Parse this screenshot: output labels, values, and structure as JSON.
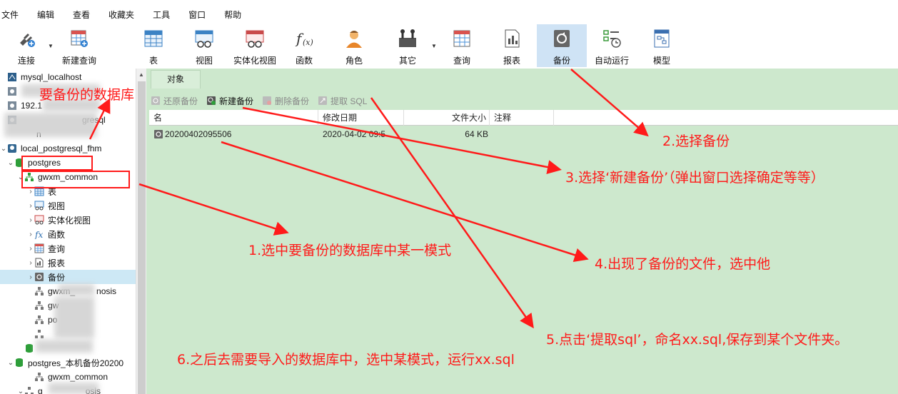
{
  "menu": [
    "文件",
    "编辑",
    "查看",
    "收藏夹",
    "工具",
    "窗口",
    "帮助"
  ],
  "toolbar": [
    {
      "label": "连接",
      "icon": "plug-icon"
    },
    {
      "label": "新建查询",
      "icon": "new-query-icon"
    },
    {
      "label": "表",
      "icon": "table-icon"
    },
    {
      "label": "视图",
      "icon": "view-icon"
    },
    {
      "label": "实体化视图",
      "icon": "materialized-view-icon"
    },
    {
      "label": "函数",
      "icon": "function-icon"
    },
    {
      "label": "角色",
      "icon": "user-icon"
    },
    {
      "label": "其它",
      "icon": "tools-icon"
    },
    {
      "label": "查询",
      "icon": "query-icon"
    },
    {
      "label": "报表",
      "icon": "report-icon"
    },
    {
      "label": "备份",
      "icon": "backup-icon"
    },
    {
      "label": "自动运行",
      "icon": "schedule-icon"
    },
    {
      "label": "模型",
      "icon": "model-icon"
    }
  ],
  "sidebar": {
    "items": [
      {
        "label": "mysql_localhost"
      },
      {
        "label": ""
      },
      {
        "label": "192.1"
      },
      {
        "label": "gresql"
      },
      {
        "label": "n"
      },
      {
        "label": "local_postgresql_fhm"
      },
      {
        "label": "postgres"
      },
      {
        "label": "gwxm_common"
      },
      {
        "label": "表"
      },
      {
        "label": "视图"
      },
      {
        "label": "实体化视图"
      },
      {
        "label": "函数"
      },
      {
        "label": "查询"
      },
      {
        "label": "报表"
      },
      {
        "label": "备份"
      },
      {
        "label": "gwxm_"
      },
      {
        "label": "nosis"
      },
      {
        "label": "gw"
      },
      {
        "label": "po"
      },
      {
        "label": "postgres_本机备份20200"
      },
      {
        "label": "gwxm_common"
      },
      {
        "label": "g"
      },
      {
        "label": "osis"
      }
    ]
  },
  "content": {
    "tab": "对象",
    "actions": [
      "还原备份",
      "新建备份",
      "删除备份",
      "提取 SQL"
    ],
    "columns": [
      "名",
      "修改日期",
      "文件大小",
      "注释"
    ],
    "rows": [
      {
        "name": "20200402095506",
        "date": "2020-04-02 09:5",
        "size": "64 KB",
        "comment": ""
      }
    ]
  },
  "annotations": {
    "select_db": "要备份的数据库",
    "step1": "1.选中要备份的数据库中某一模式",
    "step2": "2.选择备份",
    "step3": "3.选择‘新建备份’（弹出窗口选择确定等等）",
    "step4": "4.出现了备份的文件，选中他",
    "step5": "5.点击‘提取sql’，命名xx.sql,保存到某个文件夹。",
    "step6": "6.之后去需要导入的数据库中，选中某模式，运行xx.sql"
  },
  "colors": {
    "annotation": "#ff1a1a",
    "content_bg": "#cde8cd",
    "selected_tool": "#cfe3f5"
  }
}
